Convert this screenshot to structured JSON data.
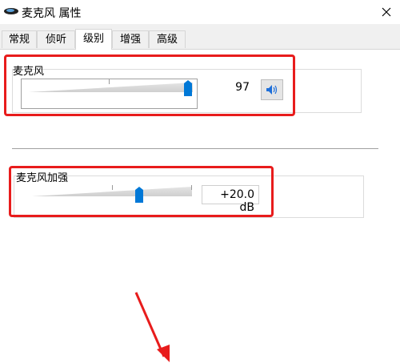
{
  "window": {
    "title": "麦克风 属性"
  },
  "tabs": [
    {
      "label": "常规",
      "active": false
    },
    {
      "label": "侦听",
      "active": false
    },
    {
      "label": "级别",
      "active": true
    },
    {
      "label": "增强",
      "active": false
    },
    {
      "label": "高级",
      "active": false
    }
  ],
  "microphone": {
    "label": "麦克风",
    "value": "97",
    "level": 97,
    "mute_icon": "speaker-icon"
  },
  "boost": {
    "label": "麦克风加强",
    "value": "+20.0 dB",
    "level": 0.67
  },
  "colors": {
    "accent": "#0078d7",
    "annotation": "#e81c1c"
  },
  "icons": {
    "window": "microphone-icon",
    "close": "close-icon"
  }
}
